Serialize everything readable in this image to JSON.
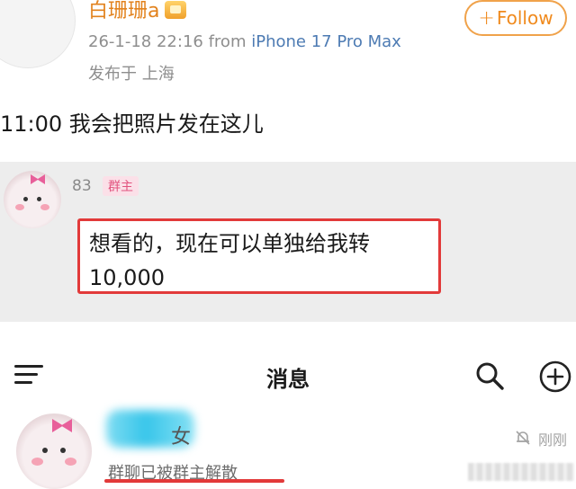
{
  "post": {
    "username": "白珊珊a",
    "timestamp": "26-1-18 22:16",
    "from_label": "from",
    "device": "iPhone 17 Pro Max",
    "location": "发布于 上海",
    "follow_label": "Follow",
    "follow_plus": "+",
    "text": "11:00 我会把照片发在这儿",
    "badge_icon": "vip-crown-icon"
  },
  "chat": {
    "sender_name": "83",
    "sender_tag": "群主",
    "message_line1": "想看的，现在可以单独给我转",
    "message_line2": "10,000",
    "highlight_color": "#e23a3a"
  },
  "messages_screen": {
    "title": "消息",
    "icons": [
      "menu-icon",
      "search-icon",
      "add-icon"
    ],
    "conversation": {
      "name_tail": "女",
      "time": "刚刚",
      "preview": "群聊已被群主解散",
      "mute_icon": "mute-bell-icon"
    }
  },
  "colors": {
    "username": "#e2821d",
    "device_link": "#4d7bb3",
    "follow_border": "#f0a24a",
    "chat_background": "#ededed",
    "owner_tag": "#e2547f"
  }
}
